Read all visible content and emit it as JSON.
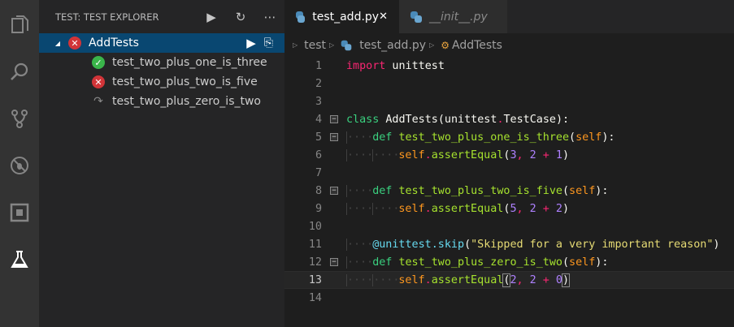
{
  "activity_bar": [
    "explorer-icon",
    "search-icon",
    "source-control-icon",
    "debug-icon",
    "extensions-icon",
    "test-icon"
  ],
  "sidebar": {
    "title": "TEST: TEST EXPLORER",
    "suite": {
      "label": "AddTests",
      "status": "failed"
    },
    "tests": [
      {
        "label": "test_two_plus_one_is_three",
        "status": "passed"
      },
      {
        "label": "test_two_plus_two_is_five",
        "status": "failed"
      },
      {
        "label": "test_two_plus_zero_is_two",
        "status": "skipped"
      }
    ]
  },
  "tabs": [
    {
      "label": "test_add.py",
      "active": true
    },
    {
      "label": "__init__.py",
      "active": false
    }
  ],
  "breadcrumbs": [
    "test",
    "test_add.py",
    "AddTests"
  ],
  "colors": {
    "passed": "#3ab54a",
    "failed": "#d13438",
    "accent": "#094771"
  },
  "current_line": 13,
  "code": [
    {
      "n": "1",
      "ind": 0,
      "fold": false,
      "t": [
        [
          "import",
          "k"
        ],
        [
          " unittest",
          "w"
        ]
      ]
    },
    {
      "n": "2",
      "ind": 0,
      "fold": false,
      "t": []
    },
    {
      "n": "3",
      "ind": 0,
      "fold": false,
      "t": []
    },
    {
      "n": "4",
      "ind": 0,
      "fold": true,
      "t": [
        [
          "class",
          "g"
        ],
        [
          " AddTests(unittest",
          "w"
        ],
        [
          ".",
          "k"
        ],
        [
          "TestCase):",
          "w"
        ]
      ]
    },
    {
      "n": "5",
      "ind": 1,
      "fold": true,
      "t": [
        [
          "def",
          "g"
        ],
        [
          " ",
          "w"
        ],
        [
          "test_two_plus_one_is_three",
          "f"
        ],
        [
          "(",
          "w"
        ],
        [
          "self",
          "s"
        ],
        [
          "):",
          "w"
        ]
      ]
    },
    {
      "n": "6",
      "ind": 2,
      "fold": false,
      "t": [
        [
          "self",
          "s"
        ],
        [
          ".",
          "k"
        ],
        [
          "assertEqual",
          "f"
        ],
        [
          "(",
          "w"
        ],
        [
          "3",
          "n"
        ],
        [
          ", ",
          "k"
        ],
        [
          "2",
          "n"
        ],
        [
          " + ",
          "k"
        ],
        [
          "1",
          "n"
        ],
        [
          ")",
          "w"
        ]
      ]
    },
    {
      "n": "7",
      "ind": 0,
      "fold": false,
      "t": []
    },
    {
      "n": "8",
      "ind": 1,
      "fold": true,
      "t": [
        [
          "def",
          "g"
        ],
        [
          " ",
          "w"
        ],
        [
          "test_two_plus_two_is_five",
          "f"
        ],
        [
          "(",
          "w"
        ],
        [
          "self",
          "s"
        ],
        [
          "):",
          "w"
        ]
      ]
    },
    {
      "n": "9",
      "ind": 2,
      "fold": false,
      "t": [
        [
          "self",
          "s"
        ],
        [
          ".",
          "k"
        ],
        [
          "assertEqual",
          "f"
        ],
        [
          "(",
          "w"
        ],
        [
          "5",
          "n"
        ],
        [
          ", ",
          "k"
        ],
        [
          "2",
          "n"
        ],
        [
          " + ",
          "k"
        ],
        [
          "2",
          "n"
        ],
        [
          ")",
          "w"
        ]
      ]
    },
    {
      "n": "10",
      "ind": 0,
      "fold": false,
      "t": []
    },
    {
      "n": "11",
      "ind": 1,
      "fold": false,
      "t": [
        [
          "@unittest.skip",
          "d"
        ],
        [
          "(",
          "w"
        ],
        [
          "\"Skipped for a very important reason\"",
          "q"
        ],
        [
          ")",
          "w"
        ]
      ]
    },
    {
      "n": "12",
      "ind": 1,
      "fold": true,
      "t": [
        [
          "def",
          "g"
        ],
        [
          " ",
          "w"
        ],
        [
          "test_two_plus_zero_is_two",
          "f"
        ],
        [
          "(",
          "w"
        ],
        [
          "self",
          "s"
        ],
        [
          "):",
          "w"
        ]
      ]
    },
    {
      "n": "13",
      "ind": 2,
      "fold": false,
      "t": [
        [
          "self",
          "s"
        ],
        [
          ".",
          "k"
        ],
        [
          "assertEqual",
          "f"
        ],
        [
          "(",
          "w br"
        ],
        [
          "2",
          "n"
        ],
        [
          ", ",
          "k"
        ],
        [
          "2",
          "n"
        ],
        [
          " + ",
          "k"
        ],
        [
          "0",
          "n"
        ],
        [
          ")",
          "w br"
        ]
      ]
    },
    {
      "n": "14",
      "ind": 0,
      "fold": false,
      "t": []
    }
  ]
}
